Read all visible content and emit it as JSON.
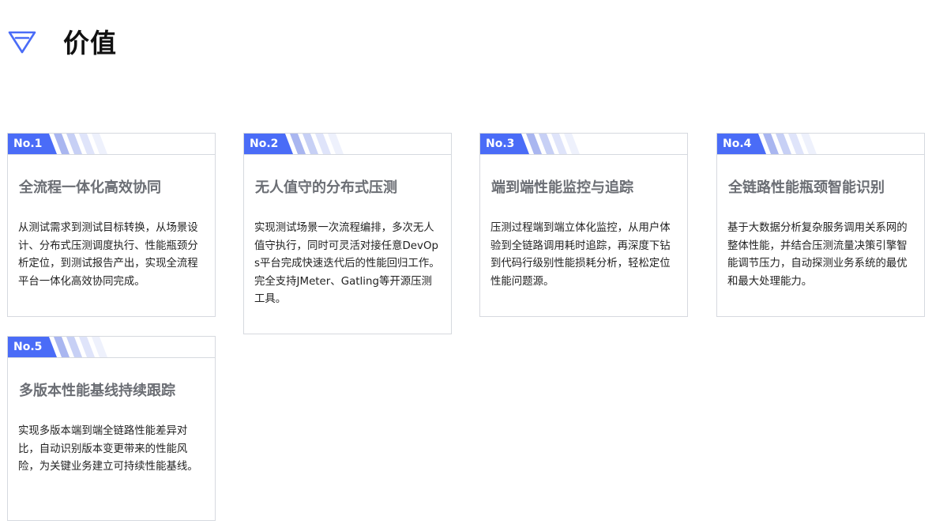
{
  "section": {
    "title": "价值",
    "icon": "diamond-icon",
    "accent_color": "#4a6cf7"
  },
  "cards": [
    {
      "badge": "No.1",
      "title": "全流程一体化高效协同",
      "description": "从测试需求到测试目标转换，从场景设计、分布式压测调度执行、性能瓶颈分析定位，到测试报告产出，实现全流程平台一体化高效协同完成。"
    },
    {
      "badge": "No.2",
      "title": "无人值守的分布式压测",
      "description": "实现测试场景一次流程编排，多次无人值守执行，同时可灵活对接任意DevOps平台完成快速迭代后的性能回归工作。完全支持JMeter、Gatling等开源压测工具。"
    },
    {
      "badge": "No.3",
      "title": "端到端性能监控与追踪",
      "description": "压测过程端到端立体化监控，从用户体验到全链路调用耗时追踪，再深度下钻到代码行级别性能损耗分析，轻松定位性能问题源。"
    },
    {
      "badge": "No.4",
      "title": "全链路性能瓶颈智能识别",
      "description": "基于大数据分析复杂服务调用关系网的整体性能，并结合压测流量决策引擎智能调节压力，自动探测业务系统的最优和最大处理能力。"
    },
    {
      "badge": "No.5",
      "title": "多版本性能基线持续跟踪",
      "description": "实现多版本端到端全链路性能差异对比，自动识别版本变更带来的性能风险，为关键业务建立可持续性能基线。"
    }
  ]
}
